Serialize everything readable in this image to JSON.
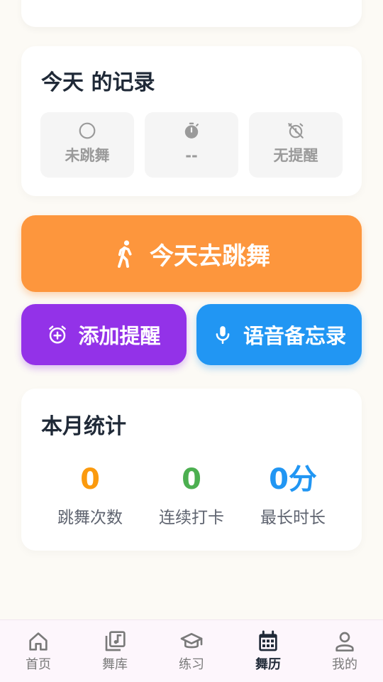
{
  "record": {
    "title": "今天 的记录",
    "tiles": [
      {
        "icon": "circle-icon",
        "label": "未跳舞"
      },
      {
        "icon": "stopwatch-icon",
        "label": "--"
      },
      {
        "icon": "alarm-off-icon",
        "label": "无提醒"
      }
    ]
  },
  "actions": {
    "main_label": "今天去跳舞",
    "reminder_label": "添加提醒",
    "voice_label": "语音备忘录"
  },
  "stats": {
    "title": "本月统计",
    "items": [
      {
        "value": "0",
        "label": "跳舞次数",
        "color": "#fb9a0e"
      },
      {
        "value": "0",
        "label": "连续打卡",
        "color": "#4caf50"
      },
      {
        "value": "0分",
        "label": "最长时长",
        "color": "#2196f3"
      }
    ]
  },
  "nav": {
    "items": [
      {
        "label": "首页",
        "icon": "home-icon"
      },
      {
        "label": "舞库",
        "icon": "music-library-icon"
      },
      {
        "label": "练习",
        "icon": "graduation-cap-icon"
      },
      {
        "label": "舞历",
        "icon": "calendar-icon",
        "active": true
      },
      {
        "label": "我的",
        "icon": "person-icon"
      }
    ]
  },
  "colors": {
    "main_button": "#fd963d",
    "reminder_button": "#9332e8",
    "voice_button": "#2196f3"
  }
}
